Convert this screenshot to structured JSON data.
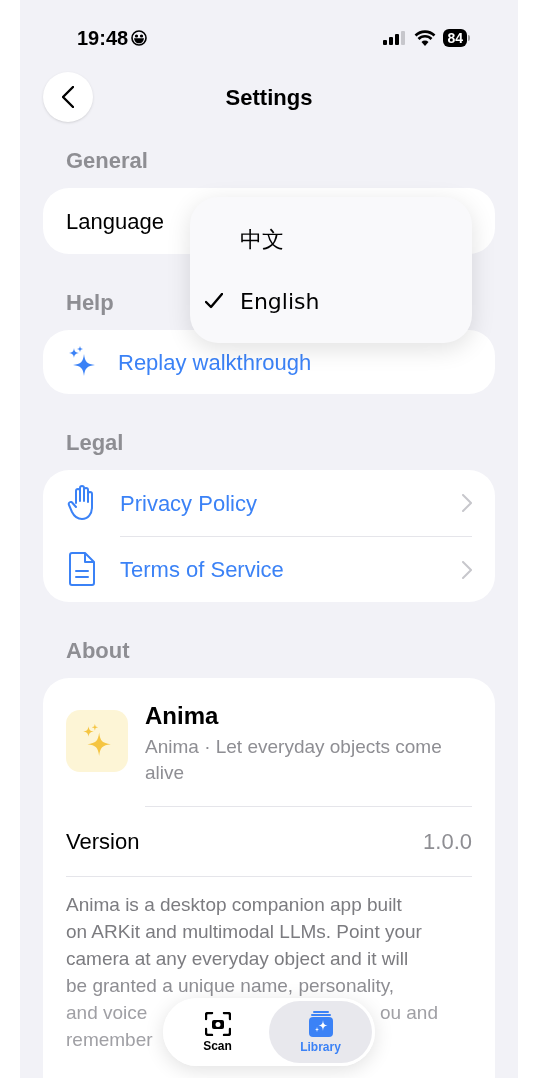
{
  "status_bar": {
    "time": "19:48",
    "battery": "84"
  },
  "nav": {
    "title": "Settings"
  },
  "general": {
    "header": "General",
    "label": "Language"
  },
  "language_menu": {
    "options": [
      {
        "label": "中文",
        "selected": false
      },
      {
        "label": "English",
        "selected": true
      }
    ]
  },
  "help": {
    "header": "Help",
    "label": "Replay walkthrough"
  },
  "legal": {
    "header": "Legal",
    "rows": [
      {
        "label": "Privacy Policy"
      },
      {
        "label": "Terms of Service"
      }
    ]
  },
  "about": {
    "header": "About",
    "app_name": "Anima",
    "tagline": "Anima · Let everyday objects come alive",
    "version_label": "Version",
    "version": "1.0.0",
    "description_lines": [
      "Anima is a desktop companion app built",
      "on ARKit and multimodal LLMs. Point your",
      "camera at any everyday object and it will",
      "be granted a unique name, personality,"
    ],
    "faded_line": {
      "left": "and voice",
      "right": "ou and"
    },
    "last_line": "remember"
  },
  "tab_bar": {
    "tabs": [
      {
        "label": "Scan",
        "selected": false
      },
      {
        "label": "Library",
        "selected": true
      }
    ]
  }
}
